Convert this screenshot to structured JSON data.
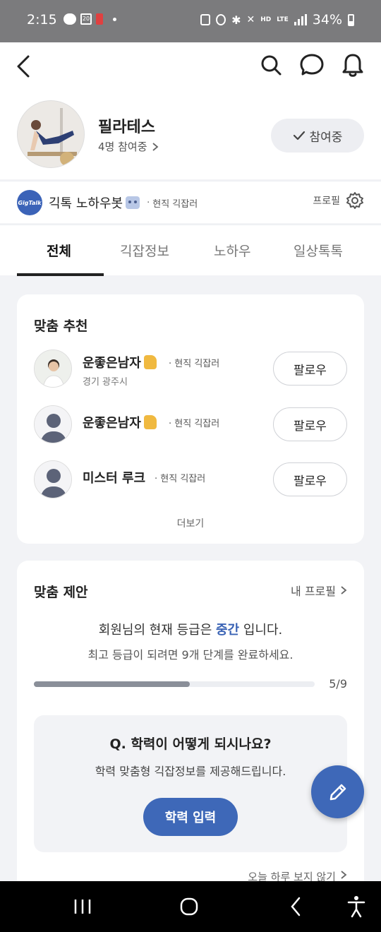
{
  "status_bar": {
    "time": "2:15",
    "calendar_day": "20",
    "battery": "34%",
    "lte": "LTE",
    "hd": "HD"
  },
  "community": {
    "name": "필라테스",
    "members": "4명 참여중",
    "joined_label": "참여중"
  },
  "profile_bar": {
    "logo_text": "GigTalk",
    "name": "긱톡 노하우봇",
    "separator": "·",
    "role": "현직 긱잡러",
    "profile_label": "프로필"
  },
  "tabs": [
    {
      "label": "전체",
      "active": true
    },
    {
      "label": "긱잡정보",
      "active": false
    },
    {
      "label": "노하우",
      "active": false
    },
    {
      "label": "일상톡톡",
      "active": false
    }
  ],
  "recommend": {
    "title": "맞춤 추천",
    "users": [
      {
        "name": "운좋은남자",
        "separator": "·",
        "role": "현직 긱잡러",
        "location": "경기 광주시",
        "follow": "팔로우"
      },
      {
        "name": "운좋은남자",
        "separator": "·",
        "role": "현직 긱잡러",
        "location": "",
        "follow": "팔로우"
      },
      {
        "name": "미스터 루크",
        "separator": "·",
        "role": "현직 긱잡러",
        "location": "",
        "follow": "팔로우"
      }
    ],
    "more": "더보기"
  },
  "suggest": {
    "title": "맞춤 제안",
    "my_profile": "내 프로필",
    "grade_prefix": "회원님의 현재 등급은 ",
    "grade": "중간",
    "grade_suffix": " 입니다.",
    "grade_sub": "최고 등급이 되려면 9개 단계를 완료하세요.",
    "progress_done": 5,
    "progress_total": 9,
    "progress_text": "5/9",
    "question_title": "Q. 학력이 어떻게 되시나요?",
    "question_sub": "학력 맞춤형 긱잡정보를 제공해드립니다.",
    "question_button": "학력 입력",
    "hide_today": "오늘 하루 보지 않기"
  },
  "colors": {
    "accent": "#3e68b8",
    "status_bar": "#7b7b7d",
    "background": "#f2f3f6"
  }
}
